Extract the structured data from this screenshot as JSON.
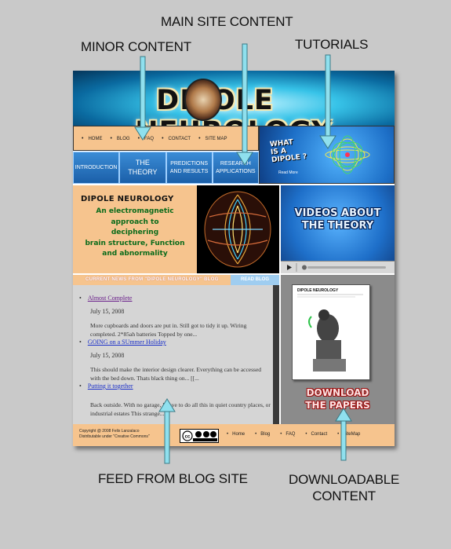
{
  "annotations": {
    "main_site_content": "MAIN SITE CONTENT",
    "minor_content": "MINOR CONTENT",
    "tutorials": "TUTORIALS",
    "feed_from_blog": "FEED FROM BLOG SITE",
    "downloadable_line1": "DOWNLOADABLE",
    "downloadable_line2": "CONTENT"
  },
  "banner": {
    "left": "DIPOLE",
    "right": "NEUROLOGY"
  },
  "top_nav": [
    "HOME",
    "BLOG",
    "FAQ",
    "CONTACT",
    "SITE MAP"
  ],
  "tabs": [
    "INTRODUCTION",
    "THE THEORY",
    "PREDICTIONS AND RESULTS",
    "RESEARCH APPLICATIONS"
  ],
  "what_is": {
    "line1": "WHAT",
    "line2": "IS A",
    "line3": "DIPOLE ?",
    "read_more": "Read More"
  },
  "intro": {
    "heading": "DIPOLE NEUROLOGY",
    "lines": [
      "An electromagnetic",
      "approach to",
      "deciphering",
      "brain structure, Function",
      "and abnormality"
    ]
  },
  "videos": {
    "line1": "VIDEOS ABOUT",
    "line2": "THE THEORY"
  },
  "news_bar": {
    "left": "CURRENT NEWS FROM \"DIPOLE NEUROLOGY\" BLOG",
    "right": "READ BLOG"
  },
  "blog": [
    {
      "title": "Almost Complete",
      "date": "July 15, 2008",
      "body": "More cupboards and doors are put in. Still got to tidy it up. Wiring completed. 2*85ah batteries Topped by one..."
    },
    {
      "title": "GOING on a SUmmer Holiday",
      "date": "July 15, 2008",
      "body": "This should make the interior design clearer. Everything can be accessed with the bed down. Thats black thing on... [[..."
    },
    {
      "title": "Putting it together",
      "date": "",
      "body": "Back outside. With no garage, I have to do all this in quiet country places, or industrial estates This strange......"
    }
  ],
  "download": {
    "paper_title": "DIPOLE NEUROLOGY",
    "line1": "DOWNLOAD",
    "line2": "THE PAPERS"
  },
  "footer": {
    "copyright": "Copyright @ 2008 Felix Lanzalaco",
    "license": "Distributable under \"Creative Commons\"",
    "nav": [
      "Home",
      "Blog",
      "FAQ",
      "Contact",
      "SiteMap"
    ]
  },
  "colors": {
    "page_bg": "#c9c9c9",
    "peach": "#f6c48e",
    "blue": "#1e6fc9",
    "arrow": "#8fe0ee"
  }
}
